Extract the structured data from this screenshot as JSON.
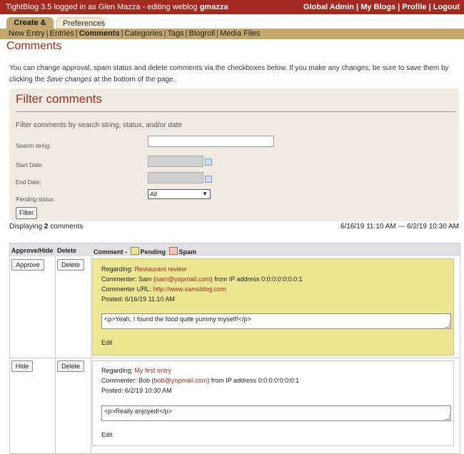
{
  "header": {
    "app_text": "TightBlog 3.5 logged in as Glen Mazza - editing weblog",
    "weblog": "gmazza",
    "links": [
      "Global Admin",
      "My Blogs",
      "Profile",
      "Logout"
    ],
    "bar_color": "#a22a20"
  },
  "tabs": [
    {
      "label": "Create & Edit",
      "active": true
    },
    {
      "label": "Preferences",
      "active": false
    }
  ],
  "subnav": [
    "New Entry",
    "Entries",
    "Comments",
    "Categories",
    "Tags",
    "Blogroll",
    "Media Files"
  ],
  "page": {
    "title": "Comments",
    "intro_1": "You can change approval, spam status and delete comments via the checkboxes below. If you make any changes, be sure to save them by clicking the",
    "intro_em": "Save changes",
    "intro_2": "at the bottom of the page."
  },
  "filter": {
    "title": "Filter comments",
    "description": "Filter comments by search string, status, and/or date",
    "search_label": "Search string:",
    "search_value": "",
    "start_label": "Start Date:",
    "end_label": "End Date:",
    "pending_label": "Pending status:",
    "pending_value": "All",
    "button_label": "Filter"
  },
  "summary": {
    "prefix": "Displaying",
    "count": "2",
    "suffix": "comments",
    "date_range": "6/16/19 11:10 AM --- 6/2/19 10:30 AM"
  },
  "table": {
    "col_approve": "Approve/Hide",
    "col_delete": "Delete",
    "col_comment": "Comment -",
    "legend_pending": "Pending",
    "legend_spam": "Spam",
    "pending_color": "#ede793",
    "spam_color": "#f2c4c4"
  },
  "comments": [
    {
      "action_label": "Approve",
      "delete_label": "Delete",
      "regarding_label": "Regarding:",
      "regarding": "Restaurant review",
      "commenter_label": "Commenter:",
      "commenter": "Sam",
      "email": "sam@yopmail.com",
      "ip_text": "from IP address 0:0:0:0:0:0:0:1",
      "url_label": "Commenter URL:",
      "url": "http://www.samsblog.com",
      "posted_label": "Posted:",
      "posted": "6/16/19 11:10 AM",
      "content": "<p>Yeah, I found the food quite yummy myself!</p>",
      "edit_label": "Edit",
      "status": "pending"
    },
    {
      "action_label": "Hide",
      "delete_label": "Delete",
      "regarding_label": "Regarding:",
      "regarding": "My first entry",
      "commenter_label": "Commenter:",
      "commenter": "Bob",
      "email": "bob@yopmail.com",
      "ip_text": "from IP address 0:0:0:0:0:0:0:1",
      "posted_label": "Posted:",
      "posted": "6/2/19 10:30 AM",
      "content": "<p>Really enjoyed!</p>",
      "edit_label": "Edit",
      "status": "approved"
    }
  ]
}
